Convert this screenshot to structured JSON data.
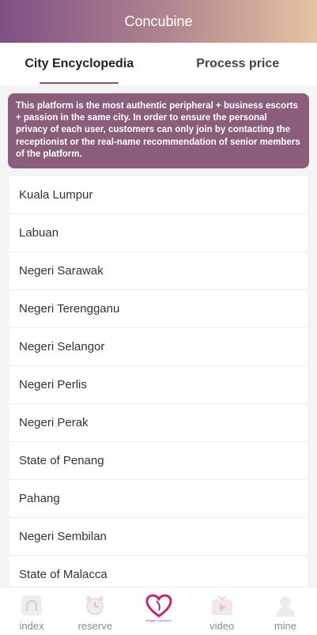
{
  "header": {
    "title": "Concubine"
  },
  "tabs": [
    {
      "label": "City Encyclopedia"
    },
    {
      "label": "Process price"
    }
  ],
  "notice": "This platform is the most authentic peripheral + business escorts + passion in the same city. In order to ensure the personal privacy of each user, customers can only join by contacting the receptionist or the real-name recommendation of senior members of the platform.",
  "cities": [
    "Kuala Lumpur",
    "Labuan",
    "Negeri Sarawak",
    "Negeri Terengganu",
    "Negeri Selangor",
    "Negeri Perlis",
    "Negeri Perak",
    "State of Penang",
    "Pahang",
    "Negeri Sembilan",
    "State of Malacca"
  ],
  "tabbar": {
    "index": "index",
    "reserve": "reserve",
    "logo_text": "elegant concubine",
    "video": "video",
    "mine": "mine"
  },
  "colors": {
    "accent": "#7e4f85",
    "notice_bg": "#8a5e7a"
  }
}
